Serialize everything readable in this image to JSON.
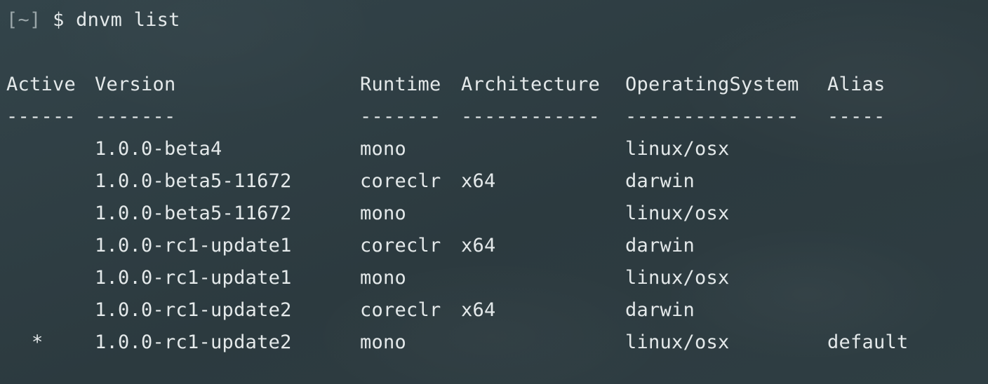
{
  "prompt": {
    "bracket_open": "[",
    "cwd": "~",
    "bracket_close": "]",
    "symbol": "$",
    "command": "dnvm list"
  },
  "table": {
    "headers": [
      "Active",
      "Version",
      "Runtime",
      "Architecture",
      "OperatingSystem",
      "Alias"
    ],
    "separators": [
      "------",
      "-------",
      "-------",
      "------------",
      "---------------",
      "-----"
    ],
    "rows": [
      {
        "active": "",
        "version": "1.0.0-beta4",
        "runtime": "mono",
        "architecture": "",
        "os": "linux/osx",
        "alias": ""
      },
      {
        "active": "",
        "version": "1.0.0-beta5-11672",
        "runtime": "coreclr",
        "architecture": "x64",
        "os": "darwin",
        "alias": ""
      },
      {
        "active": "",
        "version": "1.0.0-beta5-11672",
        "runtime": "mono",
        "architecture": "",
        "os": "linux/osx",
        "alias": ""
      },
      {
        "active": "",
        "version": "1.0.0-rc1-update1",
        "runtime": "coreclr",
        "architecture": "x64",
        "os": "darwin",
        "alias": ""
      },
      {
        "active": "",
        "version": "1.0.0-rc1-update1",
        "runtime": "mono",
        "architecture": "",
        "os": "linux/osx",
        "alias": ""
      },
      {
        "active": "",
        "version": "1.0.0-rc1-update2",
        "runtime": "coreclr",
        "architecture": "x64",
        "os": "darwin",
        "alias": ""
      },
      {
        "active": "*",
        "version": "1.0.0-rc1-update2",
        "runtime": "mono",
        "architecture": "",
        "os": "linux/osx",
        "alias": "default"
      }
    ]
  }
}
